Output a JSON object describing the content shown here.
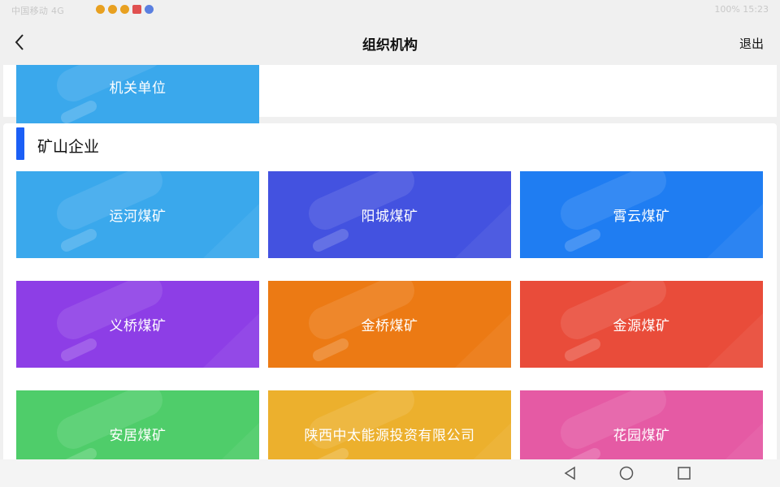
{
  "status_bar": {
    "left_text": "中国移动 4G",
    "right_text": "100% 15:23"
  },
  "header": {
    "title": "组织机构",
    "logout_label": "退出"
  },
  "top_tile": {
    "label": "机关单位",
    "color": "#3aa8ec"
  },
  "section": {
    "title": "矿山企业",
    "tiles": [
      {
        "label": "运河煤矿",
        "color": "#3aa8ec"
      },
      {
        "label": "阳城煤矿",
        "color": "#4352e0"
      },
      {
        "label": "霄云煤矿",
        "color": "#1f7df2"
      },
      {
        "label": "义桥煤矿",
        "color": "#8d3ee6"
      },
      {
        "label": "金桥煤矿",
        "color": "#ec7a14"
      },
      {
        "label": "金源煤矿",
        "color": "#e94c3a"
      },
      {
        "label": "安居煤矿",
        "color": "#4fcd6a"
      },
      {
        "label": "陕西中太能源投资有限公司",
        "color": "#ecb02d"
      },
      {
        "label": "花园煤矿",
        "color": "#e55aa4"
      }
    ]
  },
  "colors": {
    "accent": "#1b5ff6",
    "background": "#f0f0f0",
    "card": "#ffffff"
  },
  "icons": {
    "back": "chevron-left-icon",
    "nav_back": "triangle-back-icon",
    "nav_home": "circle-home-icon",
    "nav_recent": "square-recent-icon"
  }
}
